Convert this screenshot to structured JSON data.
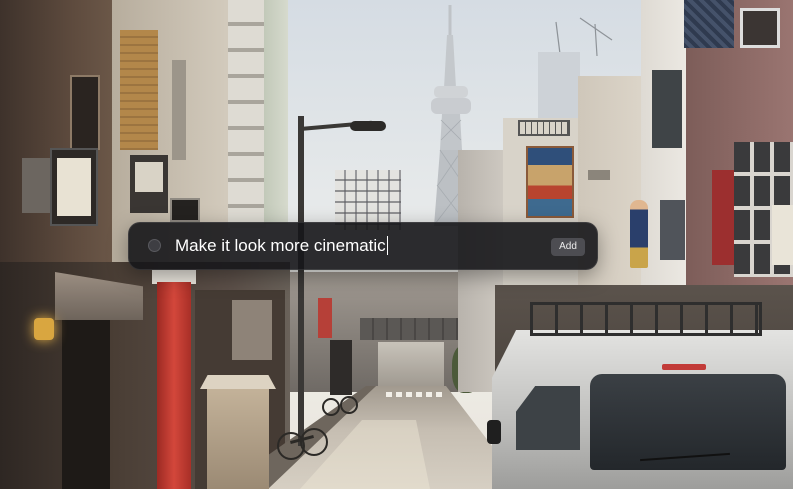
{
  "prompt_bar": {
    "leading_icon": "circle-icon",
    "input_value": "Make it look more cinematic",
    "add_button_label": "Add"
  },
  "colors": {
    "bar_background": "#16161a",
    "input_text": "#ffffff",
    "add_button_background": "#4d4d52"
  }
}
